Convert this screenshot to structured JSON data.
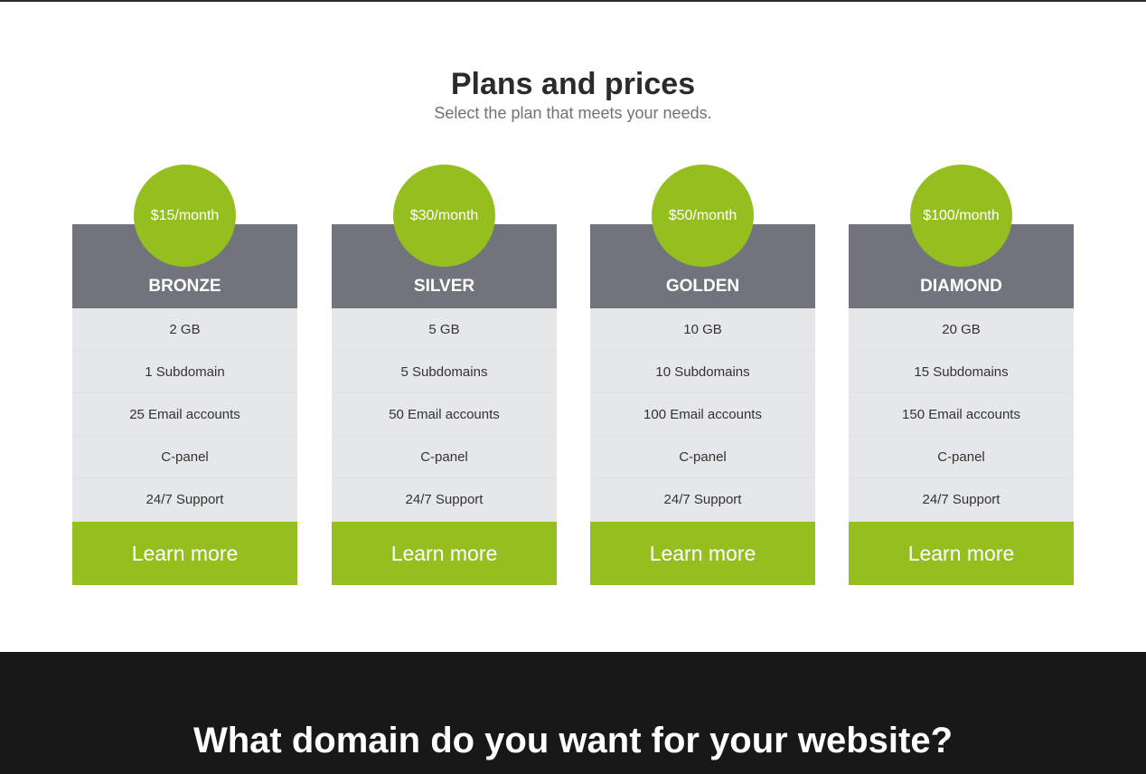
{
  "plans_section": {
    "title": "Plans and prices",
    "subtitle": "Select the plan that meets your needs."
  },
  "plans": [
    {
      "price": "$15/month",
      "name": "BRONZE",
      "features": [
        "2 GB",
        "1 Subdomain",
        "25 Email accounts",
        "C-panel",
        "24/7 Support"
      ],
      "button": "Learn more"
    },
    {
      "price": "$30/month",
      "name": "SILVER",
      "features": [
        "5 GB",
        "5 Subdomains",
        "50 Email accounts",
        "C-panel",
        "24/7 Support"
      ],
      "button": "Learn more"
    },
    {
      "price": "$50/month",
      "name": "GOLDEN",
      "features": [
        "10 GB",
        "10 Subdomains",
        "100 Email accounts",
        "C-panel",
        "24/7 Support"
      ],
      "button": "Learn more"
    },
    {
      "price": "$100/month",
      "name": "DIAMOND",
      "features": [
        "20 GB",
        "15 Subdomains",
        "150 Email accounts",
        "C-panel",
        "24/7 Support"
      ],
      "button": "Learn more"
    }
  ],
  "domain_section": {
    "title": "What domain do you want for your website?"
  },
  "colors": {
    "accent": "#95bf1f",
    "header_gray": "#71747c",
    "feature_bg": "#e6e7e8",
    "dark_bg": "#181818"
  }
}
